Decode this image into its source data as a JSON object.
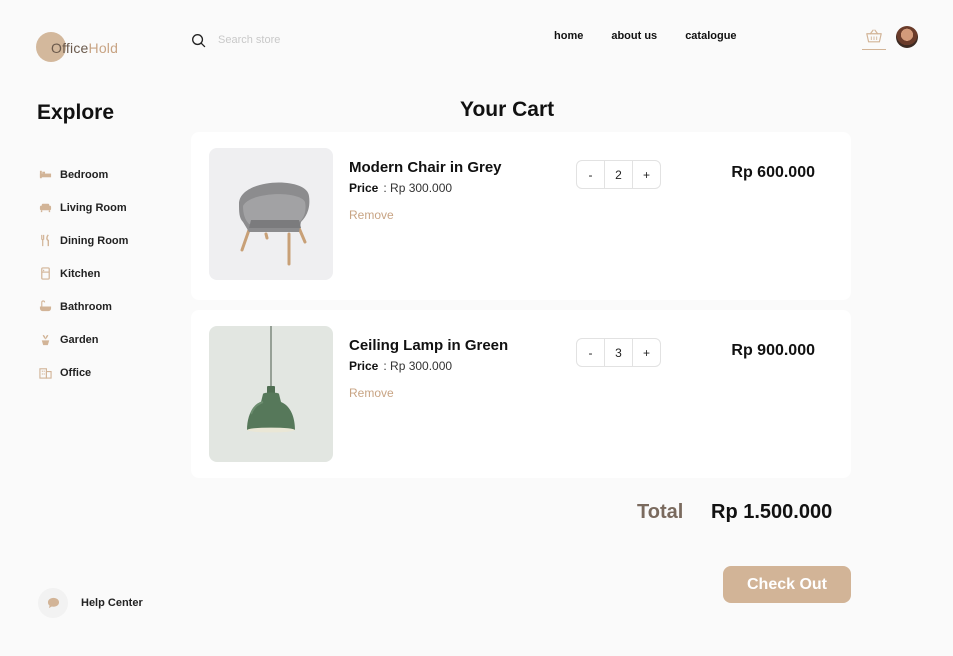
{
  "brand": {
    "part1": "Office",
    "part2": "Hold"
  },
  "search": {
    "placeholder": "Search store"
  },
  "nav": {
    "items": [
      {
        "label": "home"
      },
      {
        "label": "about us"
      },
      {
        "label": "catalogue"
      }
    ]
  },
  "sidebar": {
    "title": "Explore",
    "items": [
      {
        "label": "Bedroom",
        "icon": "bed-icon"
      },
      {
        "label": "Living Room",
        "icon": "sofa-icon"
      },
      {
        "label": "Dining Room",
        "icon": "utensils-icon"
      },
      {
        "label": "Kitchen",
        "icon": "fridge-icon"
      },
      {
        "label": "Bathroom",
        "icon": "bathtub-icon"
      },
      {
        "label": "Garden",
        "icon": "plant-icon"
      },
      {
        "label": "Office",
        "icon": "building-icon"
      }
    ],
    "help_label": "Help Center"
  },
  "cart": {
    "title": "Your Cart",
    "items": [
      {
        "name": "Modern Chair in Grey",
        "price_label": "Price",
        "price": ": Rp 300.000",
        "remove_label": "Remove",
        "dec": "-",
        "quantity": "2",
        "inc": "+",
        "line_total": "Rp 600.000"
      },
      {
        "name": "Ceiling Lamp in Green",
        "price_label": "Price",
        "price": ": Rp 300.000",
        "remove_label": "Remove",
        "dec": "-",
        "quantity": "3",
        "inc": "+",
        "line_total": "Rp 900.000"
      }
    ],
    "total_label": "Total",
    "total_value": "Rp 1.500.000",
    "checkout_label": "Check Out"
  },
  "colors": {
    "accent": "#d2b497",
    "brand_dark": "#6b5a4c",
    "text": "#111111"
  }
}
